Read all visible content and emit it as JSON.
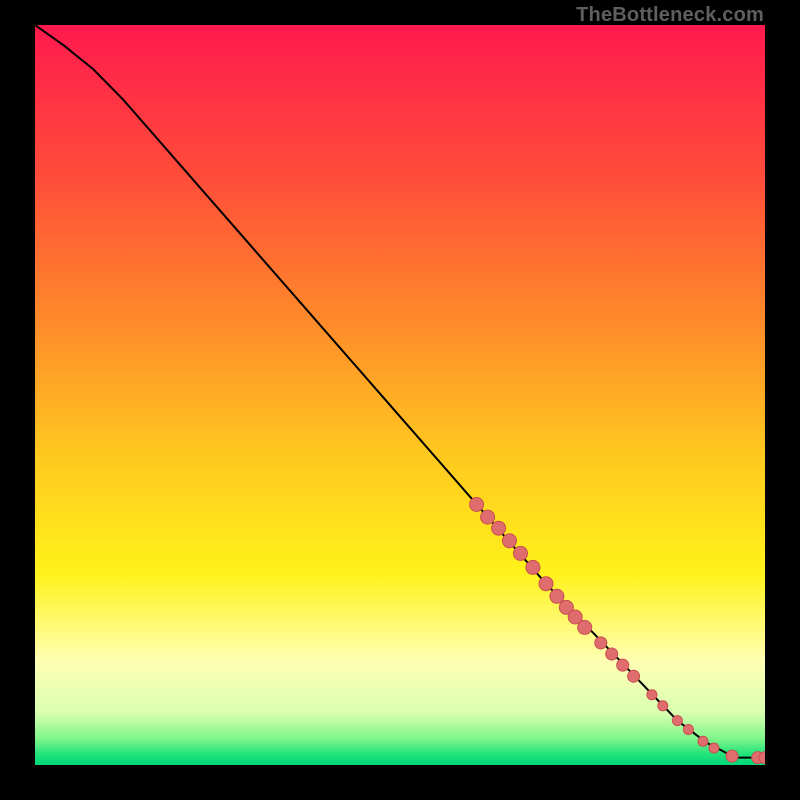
{
  "attribution": "TheBottleneck.com",
  "colors": {
    "gradient_stops": [
      {
        "offset": 0.0,
        "color": "#ff1a4e"
      },
      {
        "offset": 0.2,
        "color": "#ff4b3a"
      },
      {
        "offset": 0.4,
        "color": "#ff8a2a"
      },
      {
        "offset": 0.58,
        "color": "#ffc81f"
      },
      {
        "offset": 0.74,
        "color": "#fff21a"
      },
      {
        "offset": 0.86,
        "color": "#ffffb4"
      },
      {
        "offset": 0.93,
        "color": "#d8ffb0"
      },
      {
        "offset": 0.965,
        "color": "#7df58a"
      },
      {
        "offset": 0.985,
        "color": "#22e37a"
      },
      {
        "offset": 1.0,
        "color": "#00d87a"
      }
    ],
    "marker_fill": "#e06d6d",
    "marker_stroke": "#c84f4f",
    "line": "#000000"
  },
  "chart_data": {
    "type": "line",
    "xlim": [
      0,
      100
    ],
    "ylim": [
      0,
      100
    ],
    "curve": [
      {
        "x": 0,
        "y": 100
      },
      {
        "x": 4,
        "y": 97.2
      },
      {
        "x": 8,
        "y": 94
      },
      {
        "x": 12,
        "y": 90
      },
      {
        "x": 70,
        "y": 24.5
      },
      {
        "x": 88,
        "y": 6
      },
      {
        "x": 92,
        "y": 3
      },
      {
        "x": 94,
        "y": 2
      },
      {
        "x": 95.5,
        "y": 1.2
      },
      {
        "x": 96,
        "y": 1.0
      },
      {
        "x": 100,
        "y": 1.0
      }
    ],
    "markers": [
      {
        "x": 60.5,
        "y": 35.2,
        "r": 7
      },
      {
        "x": 62.0,
        "y": 33.5,
        "r": 7
      },
      {
        "x": 63.5,
        "y": 32.0,
        "r": 7
      },
      {
        "x": 65.0,
        "y": 30.3,
        "r": 7
      },
      {
        "x": 66.5,
        "y": 28.6,
        "r": 7
      },
      {
        "x": 68.2,
        "y": 26.7,
        "r": 7
      },
      {
        "x": 70.0,
        "y": 24.5,
        "r": 7
      },
      {
        "x": 71.5,
        "y": 22.8,
        "r": 7
      },
      {
        "x": 72.8,
        "y": 21.3,
        "r": 7
      },
      {
        "x": 74.0,
        "y": 20.0,
        "r": 7
      },
      {
        "x": 75.3,
        "y": 18.6,
        "r": 7
      },
      {
        "x": 77.5,
        "y": 16.5,
        "r": 6
      },
      {
        "x": 79.0,
        "y": 15.0,
        "r": 6
      },
      {
        "x": 80.5,
        "y": 13.5,
        "r": 6
      },
      {
        "x": 82.0,
        "y": 12.0,
        "r": 6
      },
      {
        "x": 84.5,
        "y": 9.5,
        "r": 5
      },
      {
        "x": 86.0,
        "y": 8.0,
        "r": 5
      },
      {
        "x": 88.0,
        "y": 6.0,
        "r": 5
      },
      {
        "x": 89.5,
        "y": 4.8,
        "r": 5
      },
      {
        "x": 91.5,
        "y": 3.2,
        "r": 5
      },
      {
        "x": 93.0,
        "y": 2.3,
        "r": 5
      },
      {
        "x": 95.5,
        "y": 1.2,
        "r": 6
      },
      {
        "x": 99.0,
        "y": 1.0,
        "r": 6
      },
      {
        "x": 100.0,
        "y": 1.0,
        "r": 6
      }
    ],
    "title": "",
    "xlabel": "",
    "ylabel": ""
  }
}
